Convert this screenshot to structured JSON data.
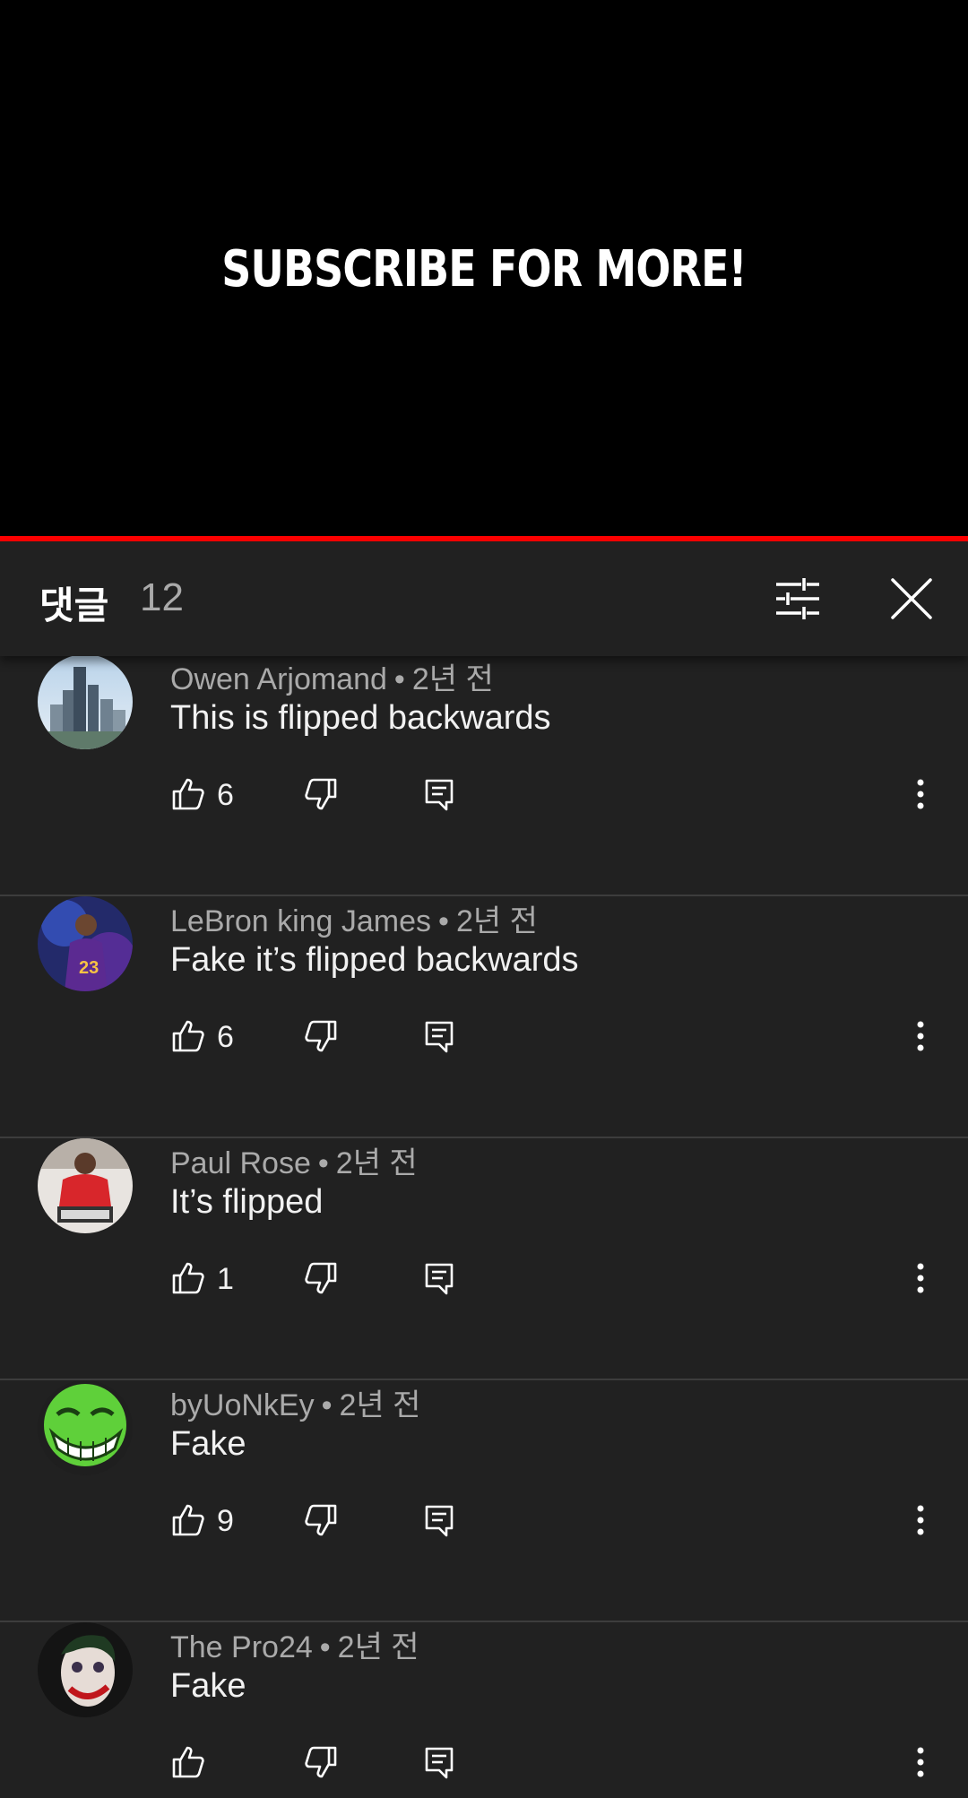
{
  "video": {
    "caption": "SUBSCRIBE FOR MORE!"
  },
  "comments_panel": {
    "title": "댓글",
    "count": "12",
    "filter_icon": "sort-filter-icon",
    "close_icon": "close-icon"
  },
  "comments": [
    {
      "author": "Owen Arjomand",
      "time": "2년 전",
      "text": "This is flipped backwards",
      "likes": "6",
      "avatar": "city-skyline-avatar"
    },
    {
      "author": "LeBron king James",
      "time": "2년 전",
      "text": "Fake it’s flipped backwards",
      "likes": "6",
      "avatar": "basketball-player-avatar"
    },
    {
      "author": "Paul Rose",
      "time": "2년 전",
      "text": "It’s flipped",
      "likes": "1",
      "avatar": "person-red-shirt-avatar"
    },
    {
      "author": "byUoNkEy",
      "time": "2년 전",
      "text": "Fake",
      "likes": "9",
      "avatar": "green-trollface-avatar"
    },
    {
      "author": "The Pro24",
      "time": "2년 전",
      "text": "Fake",
      "likes": "",
      "avatar": "joker-avatar"
    }
  ],
  "colors": {
    "background": "#212121",
    "progress": "#ff0000",
    "secondary_text": "#aaaaaa",
    "divider": "#3d3d3d"
  }
}
